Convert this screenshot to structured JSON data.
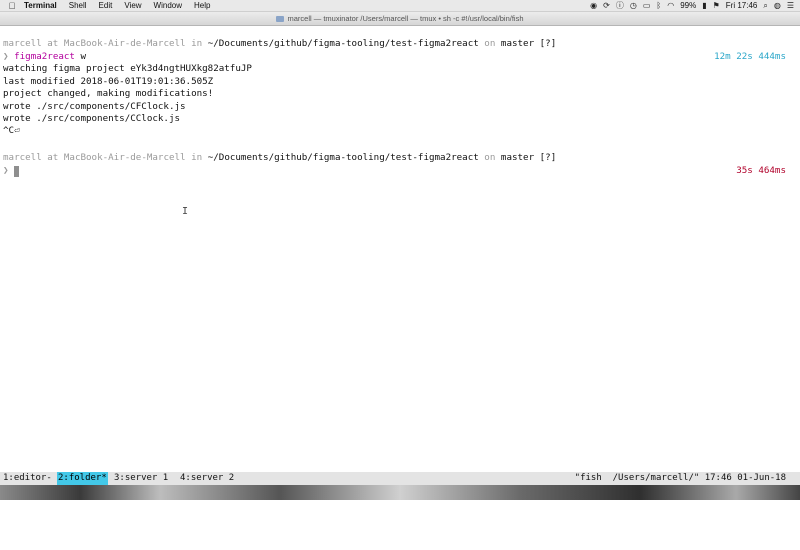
{
  "menubar": {
    "apple": "",
    "items": [
      "Terminal",
      "Shell",
      "Edit",
      "View",
      "Window",
      "Help"
    ],
    "battery": "99%",
    "clock": "Fri 17:46"
  },
  "window": {
    "title": "marcell — tmuxinator  /Users/marcell — tmux • sh -c #!/usr/local/bin/fish"
  },
  "terminal": {
    "prompt1": {
      "user": "marcell",
      "at": " at ",
      "host": "MacBook-Air-de-Marcell",
      "in": " in ",
      "path": "~/Documents/github/figma-tooling/test-figma2react",
      "on": " on ",
      "branch": "master",
      "status": " [?]"
    },
    "duration1": "12m 22s 444ms",
    "command": {
      "symbol": "❯",
      "cmd": "figma2react",
      "arg": " w"
    },
    "output": [
      "watching figma project eYk3d4ngtHUXkg82atfuJP",
      "last modified 2018-06-01T19:01:36.505Z",
      "project changed, making modifications!",
      "wrote ./src/components/CFClock.js",
      "wrote ./src/components/CClock.js",
      "^C⏎"
    ],
    "prompt2": {
      "user": "marcell",
      "at": " at ",
      "host": "MacBook-Air-de-Marcell",
      "in": " in ",
      "path": "~/Documents/github/figma-tooling/test-figma2react",
      "on": " on ",
      "branch": "master",
      "status": " [?]"
    },
    "duration2": "35s 464ms",
    "prompt_symbol": "❯"
  },
  "tmux": {
    "windows": [
      "1:editor-",
      "2:folder*",
      "3:server 1",
      "4:server 2"
    ],
    "right": "\"fish  /Users/marcell/\" 17:46 01-Jun-18"
  },
  "colors": {
    "accent_tab": "#43c8e8",
    "duration_cyan": "#2aa6c9",
    "command_magenta": "#b3009d",
    "duration_red": "#b0002a"
  }
}
